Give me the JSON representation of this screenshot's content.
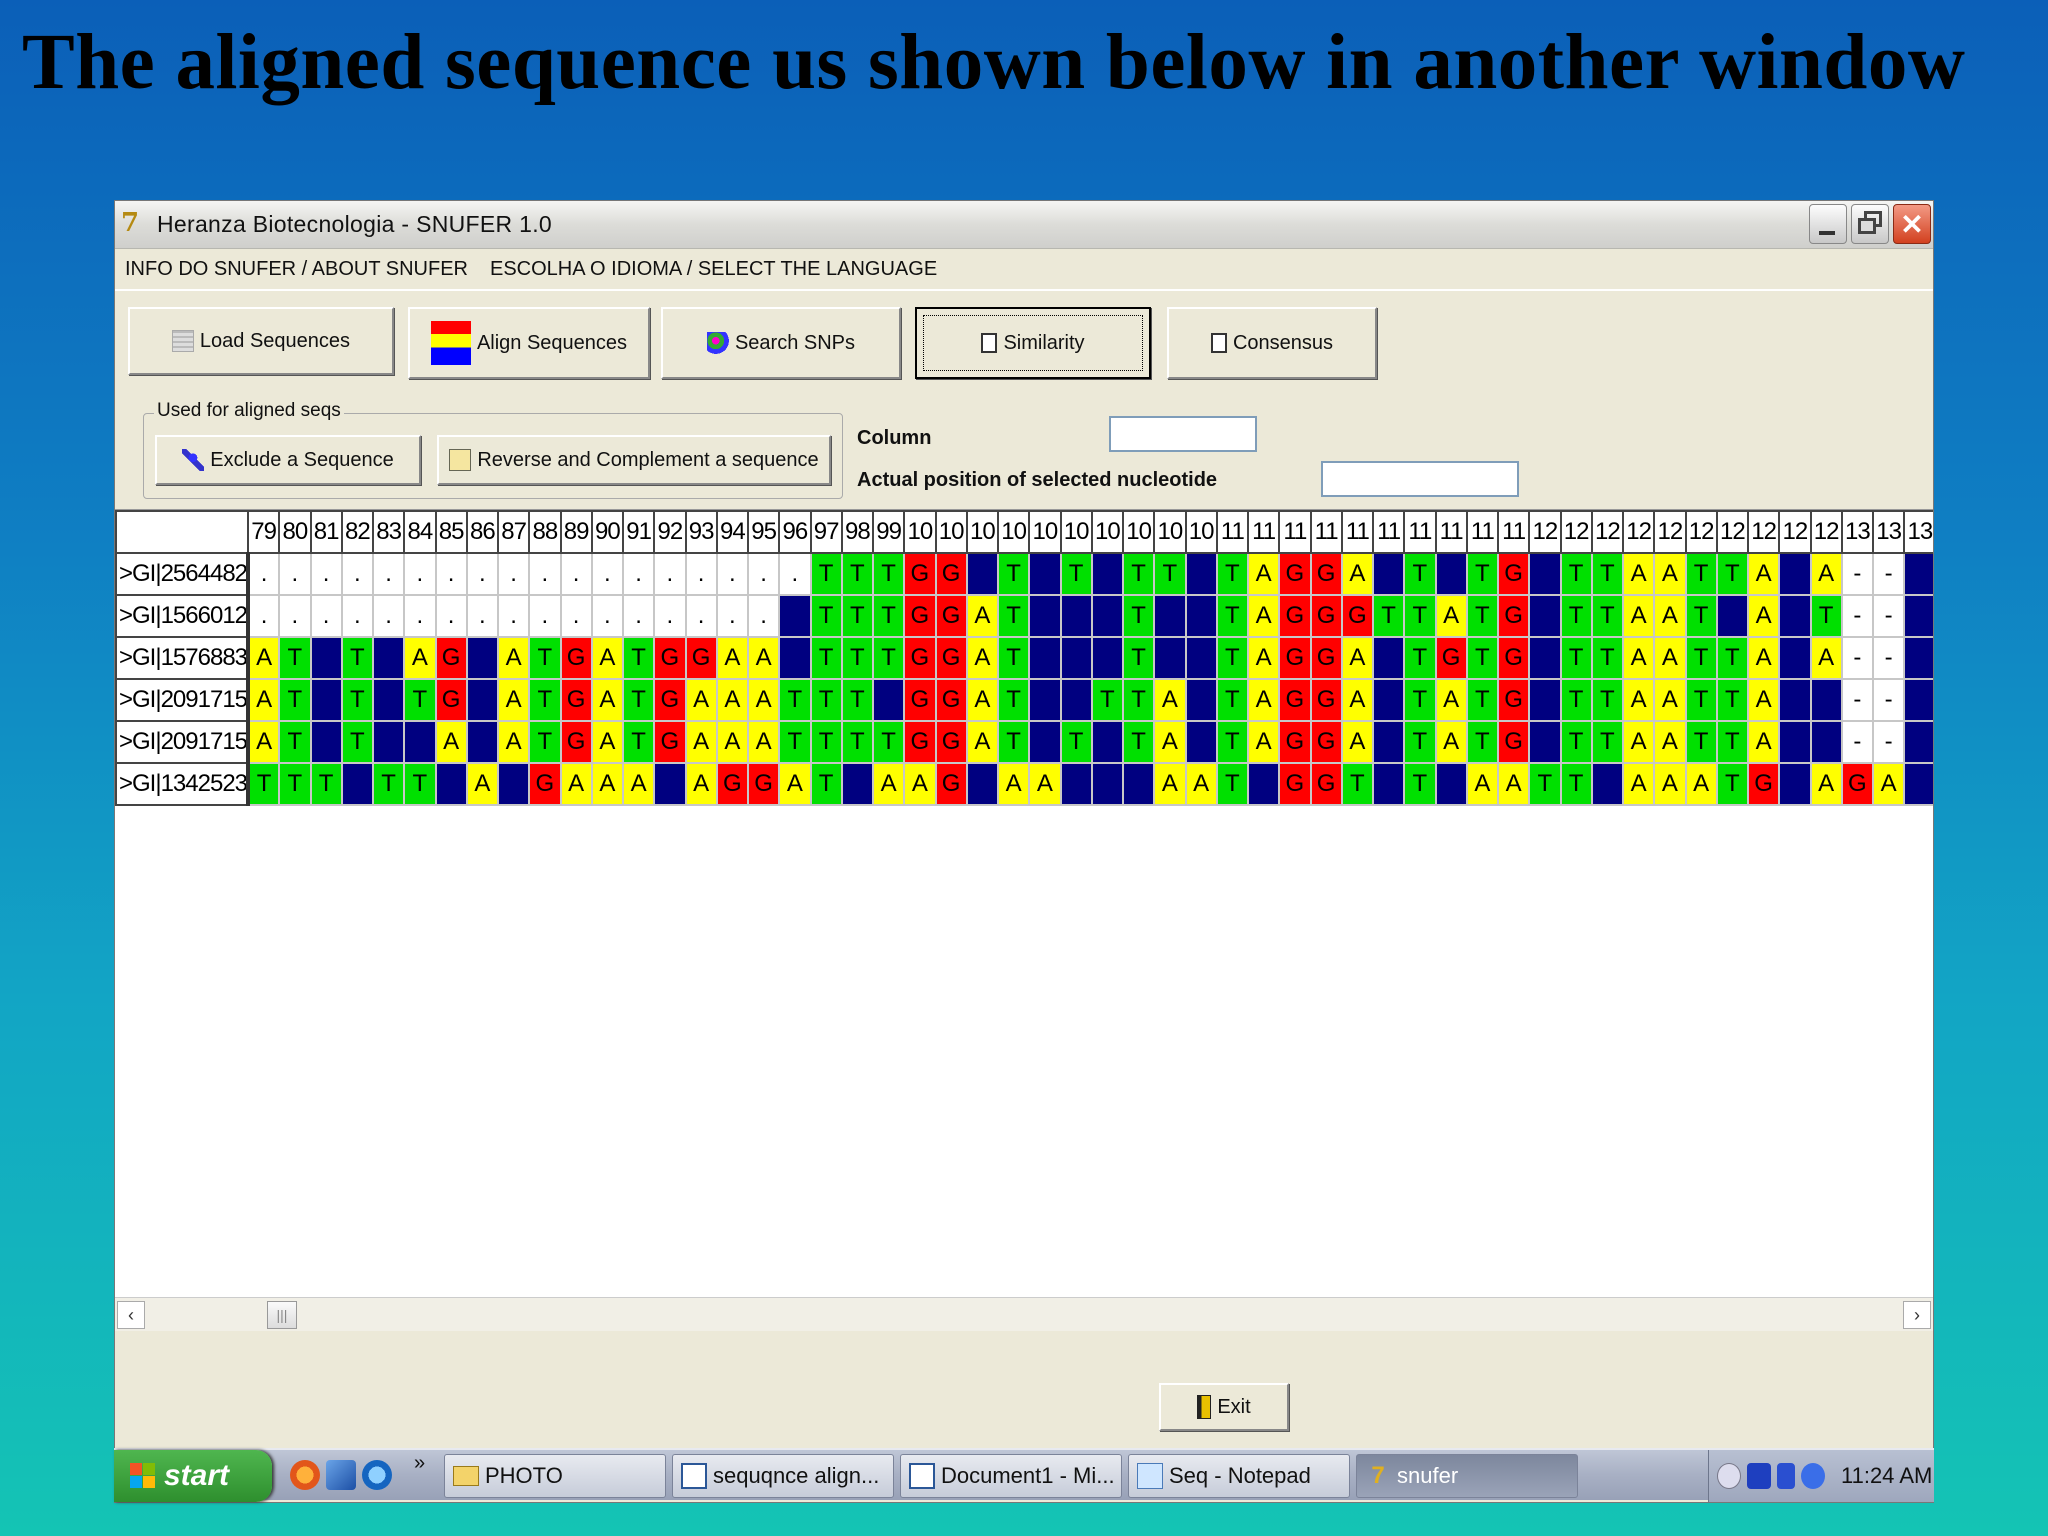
{
  "slide": {
    "title": "The aligned sequence us shown below in another window"
  },
  "window": {
    "title": "Heranza Biotecnologia - SNUFER 1.0"
  },
  "menu": [
    "INFO DO SNUFER / ABOUT SNUFER",
    "ESCOLHA O IDIOMA / SELECT THE LANGUAGE"
  ],
  "toolbar": {
    "load": "Load Sequences",
    "align": "Align Sequences",
    "search": "Search SNPs",
    "similarity": "Similarity",
    "consensus": "Consensus"
  },
  "group": {
    "label": "Used for aligned seqs",
    "exclude": "Exclude a Sequence",
    "reverse": "Reverse and Complement a sequence"
  },
  "fields": {
    "column_label": "Column",
    "column_value": "",
    "position_label": "Actual position of selected nucleotide",
    "position_value": ""
  },
  "grid": {
    "headers": [
      "79",
      "80",
      "81",
      "82",
      "83",
      "84",
      "85",
      "86",
      "87",
      "88",
      "89",
      "90",
      "91",
      "92",
      "93",
      "94",
      "95",
      "96",
      "97",
      "98",
      "99",
      "10",
      "10",
      "10",
      "10",
      "10",
      "10",
      "10",
      "10",
      "10",
      "10",
      "11",
      "11",
      "11",
      "11",
      "11",
      "11",
      "11",
      "11",
      "11",
      "11",
      "12",
      "12",
      "12",
      "12",
      "12",
      "12",
      "12",
      "12",
      "12",
      "12",
      "13",
      "13",
      "13"
    ],
    "rows": [
      {
        "label": ">GI|2564482",
        "seq": "..................TTTGGCTCTCTTCTAGGACTCTGCTTAATTACA--C"
      },
      {
        "label": ">GI|1566012",
        "seq": ".................CTTTGGATCCCTCCTAGGGTTATGCTTAATCACT--C"
      },
      {
        "label": ">GI|1576883",
        "seq": "ATCTCAGCATGATGGAACTTTGGATCCCTCCTAGGACTGTGCTTAATTACA--C"
      },
      {
        "label": ">GI|2091715",
        "seq": "ATCTCTGCATGATGAAATTTCGGATCCTTACTAGGACTATGCTTAATTACC--C"
      },
      {
        "label": ">GI|2091715",
        "seq": "ATCTCCACATGATGAAATTTTGGATCTCTACTAGGACTATGCTTAATTACC--C"
      },
      {
        "label": ">GI|1342523",
        "seq": "TTTCTTCACGAAACAGGATCAAGCAACCCAATCGGTCTCAATTCAAATGCAGAC"
      }
    ]
  },
  "exit": "Exit",
  "taskbar": {
    "start": "start",
    "chevron": "»",
    "tasks": [
      "PHOTO",
      "sequqnce align...",
      "Document1 - Mi...",
      "Seq - Notepad",
      "snufer"
    ],
    "clock": "11:24 AM"
  },
  "colors": {
    "A": "#ffff00",
    "T": "#00e000",
    "G": "#ff0000",
    "C": "#000080"
  }
}
